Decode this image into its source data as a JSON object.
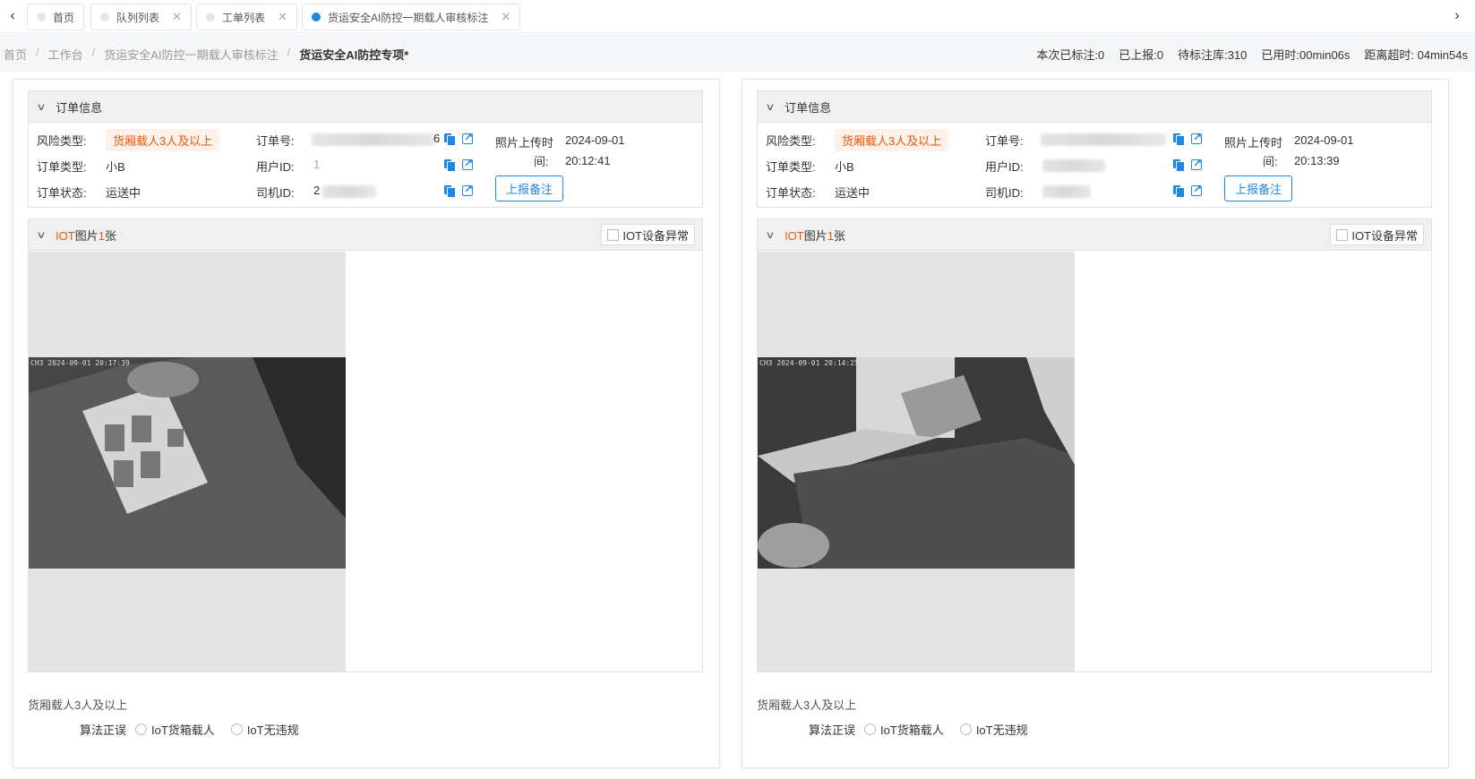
{
  "tabs": [
    {
      "label": "首页",
      "closable": false,
      "active": false
    },
    {
      "label": "队列列表",
      "closable": true,
      "active": false
    },
    {
      "label": "工单列表",
      "closable": true,
      "active": false
    },
    {
      "label": "货运安全AI防控一期载人审核标注",
      "closable": true,
      "active": true
    }
  ],
  "breadcrumb": [
    "首页",
    "工作台",
    "货运安全AI防控一期载人审核标注",
    "货运安全AI防控专项*"
  ],
  "stats": {
    "labeled": "本次已标注:0",
    "reported": "已上报:0",
    "pending": "待标注库:310",
    "elapsed": "已用时:00min06s",
    "timeout": "距离超时: 04min54s"
  },
  "panels": [
    {
      "order_section_title": "订单信息",
      "risk_type_label": "风险类型:",
      "risk_type_value": "货厢载人3人及以上",
      "order_type_label": "订单类型:",
      "order_type_value": "小B",
      "order_status_label": "订单状态:",
      "order_status_value": "运送中",
      "order_no_label": "订单号:",
      "order_no_tail": "6",
      "user_id_label": "用户ID:",
      "user_id_head": "1",
      "driver_id_label": "司机ID:",
      "driver_id_head": "2",
      "upload_time_label_1": "照片上传时",
      "upload_time_label_2": "间:",
      "upload_date": "2024-09-01",
      "upload_time": "20:12:41",
      "report_button": "上报备注",
      "iot_prefix": "IOT",
      "iot_mid": "图片",
      "iot_count": "1",
      "iot_suffix": "张",
      "iot_abnormal_label": "IOT设备异常",
      "photo_stamp": "CH3 2024-09-01 20:17:39",
      "result_label": "货厢载人3人及以上",
      "algo_label": "算法正误",
      "option_1": "IoT货箱载人",
      "option_2": "IoT无违规"
    },
    {
      "order_section_title": "订单信息",
      "risk_type_label": "风险类型:",
      "risk_type_value": "货厢载人3人及以上",
      "order_type_label": "订单类型:",
      "order_type_value": "小B",
      "order_status_label": "订单状态:",
      "order_status_value": "运送中",
      "order_no_label": "订单号:",
      "order_no_tail": "",
      "user_id_label": "用户ID:",
      "user_id_head": "",
      "driver_id_label": "司机ID:",
      "driver_id_head": "",
      "upload_time_label_1": "照片上传时",
      "upload_time_label_2": "间:",
      "upload_date": "2024-09-01",
      "upload_time": "20:13:39",
      "report_button": "上报备注",
      "iot_prefix": "IOT",
      "iot_mid": "图片",
      "iot_count": "1",
      "iot_suffix": "张",
      "iot_abnormal_label": "IOT设备异常",
      "photo_stamp": "CH3 2024-09-01 20:14:25",
      "result_label": "货厢载人3人及以上",
      "algo_label": "算法正误",
      "option_1": "IoT货箱载人",
      "option_2": "IoT无违规"
    }
  ],
  "colors": {
    "accent": "#1e88e5",
    "warning": "#e8590c"
  }
}
